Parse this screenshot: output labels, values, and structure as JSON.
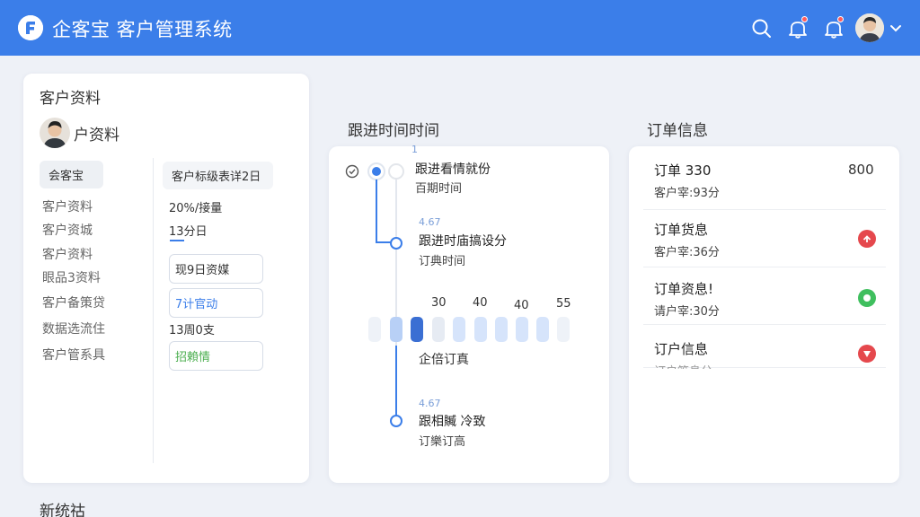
{
  "header": {
    "app_title": "企客宝 客户管理系统",
    "icons": [
      "logo-icon",
      "search-icon",
      "bell-icon",
      "bell-icon",
      "avatar",
      "chevron-down-icon"
    ],
    "accent": "#3b7ee9"
  },
  "customer": {
    "section_title": "客户资料",
    "profile_title": "户资料",
    "company_tag": "会客宝",
    "info_tag": "客户标级表详2日",
    "fields": [
      "客户资料",
      "客户资城",
      "客户资料",
      "眼品3资料",
      "客户备策贷",
      "数据选流住",
      "客户管系具"
    ],
    "values": {
      "v1": "20%/接量",
      "v2": "13分日",
      "v3": "现9日资媒",
      "v4": "7计官动",
      "v5": "13周0支",
      "v6": "招賴情"
    }
  },
  "timeline": {
    "section_title": "跟进时间时间",
    "items": [
      {
        "tag": "1",
        "title": "跟进看情就份",
        "sub": "百期时间"
      },
      {
        "tag": "4.67",
        "title": "跟进时庙搞设分",
        "sub": "订典时间"
      },
      {
        "tag": "4.67",
        "title": "跟相贓 冷致",
        "sub": "订樂订高"
      }
    ],
    "bar_labels": [
      "30",
      "40",
      "40",
      "55"
    ],
    "bar_caption": "企倍订真"
  },
  "orders": {
    "section_title": "订单信息",
    "rows": [
      {
        "title": "订单 330",
        "sub": "客户宰:93分",
        "value": "800"
      },
      {
        "title": "订单货息",
        "sub": "客户宰:36分",
        "status_color": "#e5484d"
      },
      {
        "title": "订单资息!",
        "sub": "请户宰:30分",
        "status_color": "#3fbf5e"
      },
      {
        "title": "订户信息",
        "sub": "订户答息分",
        "status_color": "#e5484d"
      }
    ]
  },
  "footer": {
    "section_title": "新统祜"
  }
}
